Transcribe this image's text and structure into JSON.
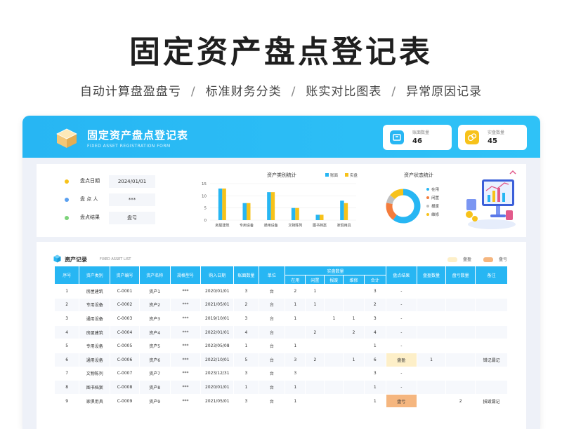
{
  "hero": {
    "title": "固定资产盘点登记表",
    "features": [
      "自动计算盘盈盘亏",
      "标准财务分类",
      "账实对比图表",
      "异常原因记录"
    ],
    "separator": "/"
  },
  "banner": {
    "title": "固定资产盘点登记表",
    "subtitle_en": "FIXED ASSET REGISTRATION FORM",
    "stats": [
      {
        "label": "账面数量",
        "value": "46",
        "color": "#27b6f3"
      },
      {
        "label": "实盘数量",
        "value": "45",
        "color": "#f7c21a"
      }
    ]
  },
  "info": [
    {
      "label": "盘点日期",
      "value": "2024/01/01",
      "dot": "#f7c21a"
    },
    {
      "label": "盘 点 人",
      "value": "***",
      "dot": "#5aa0f0"
    },
    {
      "label": "盘点结果",
      "value": "盘亏",
      "dot": "#7cd37a"
    }
  ],
  "chart_data": [
    {
      "type": "bar",
      "title": "资产类别统计",
      "categories": [
        "房屋建筑",
        "专用设备",
        "通用设备",
        "文物陈列",
        "图书档案",
        "家俱用具"
      ],
      "series": [
        {
          "name": "账面",
          "values": [
            13,
            7,
            11.5,
            5,
            2.2,
            8
          ],
          "color": "#27b6f3"
        },
        {
          "name": "实盘",
          "values": [
            13,
            7,
            11.5,
            5,
            2.2,
            7
          ],
          "color": "#f7c21a"
        }
      ],
      "yticks": [
        "0",
        "5",
        "10",
        "15"
      ],
      "ylim": [
        0,
        15
      ]
    },
    {
      "type": "pie",
      "title": "资产状态统计",
      "labels": [
        "在用",
        "闲置",
        "报废",
        "维修"
      ],
      "values": [
        60,
        18,
        8,
        14
      ],
      "colors": [
        "#27b6f3",
        "#f47c3c",
        "#bfbfbf",
        "#f7c21a"
      ]
    }
  ],
  "records": {
    "title": "资产记录",
    "title_en": "FIXED ASSET LIST",
    "legend": [
      {
        "label": "盘盈",
        "color": "#fdefc8"
      },
      {
        "label": "盘亏",
        "color": "#f5b67f"
      }
    ],
    "header_group": "实盘数量",
    "headers": [
      "序号",
      "资产类别",
      "资产编号",
      "资产名称",
      "规格型号",
      "购入日期",
      "账面数量",
      "单位",
      "在用",
      "闲置",
      "报废",
      "维修",
      "合计",
      "盘点结果",
      "盘盈数量",
      "盘亏数量",
      "备注"
    ],
    "rows": [
      [
        "1",
        "房屋建筑",
        "C-0001",
        "资产1",
        "***",
        "2020/01/01",
        "3",
        "台",
        "2",
        "1",
        "",
        "",
        "3",
        "-",
        "",
        "",
        ""
      ],
      [
        "2",
        "专用设备",
        "C-0002",
        "资产2",
        "***",
        "2021/05/01",
        "2",
        "台",
        "1",
        "1",
        "",
        "",
        "2",
        "-",
        "",
        "",
        ""
      ],
      [
        "3",
        "通用设备",
        "C-0003",
        "资产3",
        "***",
        "2019/10/01",
        "3",
        "台",
        "1",
        "",
        "1",
        "1",
        "3",
        "-",
        "",
        "",
        ""
      ],
      [
        "4",
        "房屋建筑",
        "C-0004",
        "资产4",
        "***",
        "2022/01/01",
        "4",
        "台",
        "",
        "2",
        "",
        "2",
        "4",
        "-",
        "",
        "",
        ""
      ],
      [
        "5",
        "专用设备",
        "C-0005",
        "资产5",
        "***",
        "2023/05/08",
        "1",
        "台",
        "1",
        "",
        "",
        "",
        "1",
        "-",
        "",
        "",
        ""
      ],
      [
        "6",
        "通用设备",
        "C-0006",
        "资产6",
        "***",
        "2022/10/01",
        "5",
        "台",
        "3",
        "2",
        "",
        "1",
        "6",
        "盘盈",
        "1",
        "",
        "错记漏记"
      ],
      [
        "7",
        "文物陈列",
        "C-0007",
        "资产7",
        "***",
        "2023/12/31",
        "3",
        "台",
        "3",
        "",
        "",
        "",
        "3",
        "-",
        "",
        "",
        ""
      ],
      [
        "8",
        "图书档案",
        "C-0008",
        "资产8",
        "***",
        "2020/01/01",
        "1",
        "台",
        "1",
        "",
        "",
        "",
        "1",
        "-",
        "",
        "",
        ""
      ],
      [
        "9",
        "家俱用具",
        "C-0009",
        "资产9",
        "***",
        "2021/05/01",
        "3",
        "台",
        "1",
        "",
        "",
        "",
        "1",
        "盘亏",
        "",
        "2",
        "损毁漏记"
      ]
    ]
  }
}
